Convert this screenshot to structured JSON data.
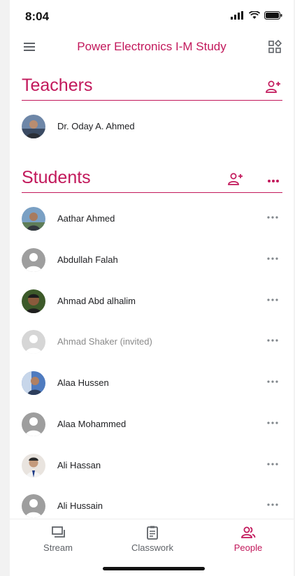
{
  "status": {
    "time": "8:04"
  },
  "header": {
    "title": "Power Electronics I-M Study"
  },
  "teachers": {
    "title": "Teachers",
    "items": [
      {
        "name": "Dr. Oday A. Ahmed"
      }
    ]
  },
  "students": {
    "title": "Students",
    "items": [
      {
        "name": "Aathar Ahmed"
      },
      {
        "name": "Abdullah Falah"
      },
      {
        "name": "Ahmad Abd alhalim"
      },
      {
        "name": "Ahmad Shaker (invited)"
      },
      {
        "name": "Alaa Hussen"
      },
      {
        "name": "Alaa Mohammed"
      },
      {
        "name": "Ali Hassan"
      },
      {
        "name": "Ali Hussain"
      }
    ]
  },
  "nav": {
    "stream": "Stream",
    "classwork": "Classwork",
    "people": "People"
  },
  "colors": {
    "accent": "#c2185b",
    "icon_gray": "#5f6368",
    "placeholder_avatar": "#9e9e9e"
  },
  "icons": [
    "menu-icon",
    "grid-icon",
    "add-person-icon",
    "more-icon",
    "stream-icon",
    "classwork-icon",
    "people-icon"
  ]
}
